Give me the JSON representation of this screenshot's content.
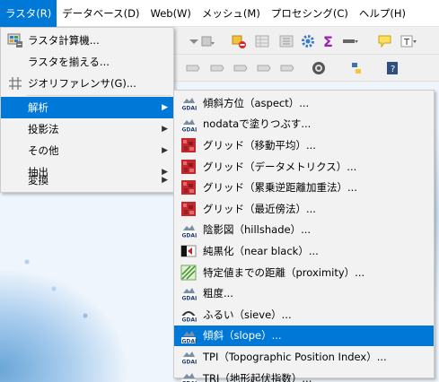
{
  "menubar": {
    "items": [
      {
        "label": "ラスタ(R)",
        "active": true
      },
      {
        "label": "データベース(D)"
      },
      {
        "label": "Web(W)"
      },
      {
        "label": "メッシュ(M)"
      },
      {
        "label": "プロセシング(C)"
      },
      {
        "label": "ヘルプ(H)"
      }
    ]
  },
  "raster_menu": {
    "items": [
      {
        "label": "ラスタ計算機...",
        "icon": "raster-calculator-icon"
      },
      {
        "label": "ラスタを揃える...",
        "icon": ""
      },
      {
        "label": "ジオリファレンサ(G)...",
        "icon": "georeferencer-icon"
      },
      {
        "label": "解析",
        "submenu": true,
        "highlighted": true
      },
      {
        "label": "投影法",
        "submenu": true
      },
      {
        "label": "その他",
        "submenu": true
      },
      {
        "label": "抽出",
        "submenu": true
      },
      {
        "label": "変換",
        "submenu": true
      }
    ],
    "arrow": "▶"
  },
  "analysis_submenu": {
    "items": [
      {
        "label": "傾斜方位（aspect）...",
        "icon": "gdal-icon"
      },
      {
        "label": "nodataで塗りつぶす...",
        "icon": "gdal-icon"
      },
      {
        "label": "グリッド（移動平均）...",
        "icon": "grid-icon"
      },
      {
        "label": "グリッド（データメトリクス）...",
        "icon": "grid-icon"
      },
      {
        "label": "グリッド（累乗逆距離加重法）...",
        "icon": "grid-icon"
      },
      {
        "label": "グリッド（最近傍法）...",
        "icon": "grid-icon"
      },
      {
        "label": "陰影図（hillshade）...",
        "icon": "gdal-icon"
      },
      {
        "label": "純黒化（near black）...",
        "icon": "nearblack-icon"
      },
      {
        "label": "特定値までの距離（proximity）...",
        "icon": "proximity-icon"
      },
      {
        "label": "粗度...",
        "icon": "gdal-icon"
      },
      {
        "label": "ふるい（sieve）...",
        "icon": "sieve-icon"
      },
      {
        "label": "傾斜（slope）...",
        "icon": "gdal-icon",
        "highlighted": true
      },
      {
        "label": "TPI（Topographic Position Index）...",
        "icon": "gdal-icon"
      },
      {
        "label": "TRI（地形起伏指数）...",
        "icon": "gdal-icon"
      }
    ]
  },
  "colors": {
    "accent": "#0078d7",
    "menu_bg": "#f2f2f2",
    "grid_icon": "#c0282d"
  }
}
